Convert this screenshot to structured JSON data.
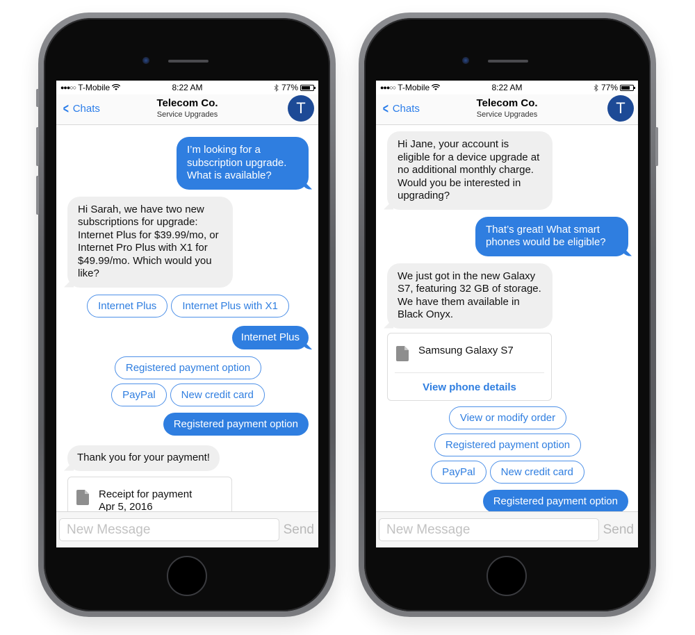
{
  "phones": [
    {
      "status": {
        "carrier": "T-Mobile",
        "signal": "●●●○○",
        "time": "8:22 AM",
        "battery": "77%",
        "battery_level": 0.77
      },
      "nav": {
        "back_label": "Chats",
        "title": "Telecom Co.",
        "subtitle": "Service Upgrades",
        "avatar_initial": "T"
      },
      "messages": [
        {
          "type": "out",
          "text": "I’m looking for a subscription upgrade. What is available?"
        },
        {
          "type": "in",
          "text": "Hi Sarah, we have two new subscriptions for upgrade: Internet Plus for $39.99/mo, or Internet Pro Plus with X1 for $49.99/mo. Which would you like?"
        },
        {
          "type": "chips",
          "items": [
            "Internet Plus",
            "Internet Plus with X1"
          ]
        },
        {
          "type": "out",
          "text": "Internet Plus"
        },
        {
          "type": "chips",
          "items": [
            "Registered payment option"
          ]
        },
        {
          "type": "chips",
          "items": [
            "PayPal",
            "New credit card"
          ]
        },
        {
          "type": "out-chip",
          "text": "Registered payment option"
        },
        {
          "type": "in",
          "text": "Thank you for your payment!"
        },
        {
          "type": "card",
          "title": "Receipt for payment",
          "subtitle": "Apr 5, 2016"
        }
      ],
      "composer": {
        "placeholder": "New Message",
        "send_label": "Send"
      }
    },
    {
      "status": {
        "carrier": "T-Mobile",
        "signal": "●●●○○",
        "time": "8:22 AM",
        "battery": "77%",
        "battery_level": 0.77
      },
      "nav": {
        "back_label": "Chats",
        "title": "Telecom Co.",
        "subtitle": "Service Upgrades",
        "avatar_initial": "T"
      },
      "messages": [
        {
          "type": "in",
          "text": "Hi Jane, your account is eligible for a device upgrade at no additional monthly charge. Would you be interested in upgrading?"
        },
        {
          "type": "out",
          "text": "That’s great! What smart phones would be eligible?"
        },
        {
          "type": "in",
          "text": "We just got in the new Galaxy S7, featuring 32 GB of storage. We have them available in Black Onyx."
        },
        {
          "type": "card",
          "title": "Samsung Galaxy S7",
          "link": "View phone details"
        },
        {
          "type": "chips",
          "items": [
            "View or modify order"
          ]
        },
        {
          "type": "chips",
          "items": [
            "Registered payment option"
          ]
        },
        {
          "type": "chips",
          "items": [
            "PayPal",
            "New credit card"
          ]
        },
        {
          "type": "out-chip",
          "text": "Registered payment option"
        }
      ],
      "composer": {
        "placeholder": "New Message",
        "send_label": "Send"
      }
    }
  ],
  "colors": {
    "accent": "#2f7ee0",
    "avatar": "#1d4a96",
    "incoming_bubble": "#efefef"
  }
}
